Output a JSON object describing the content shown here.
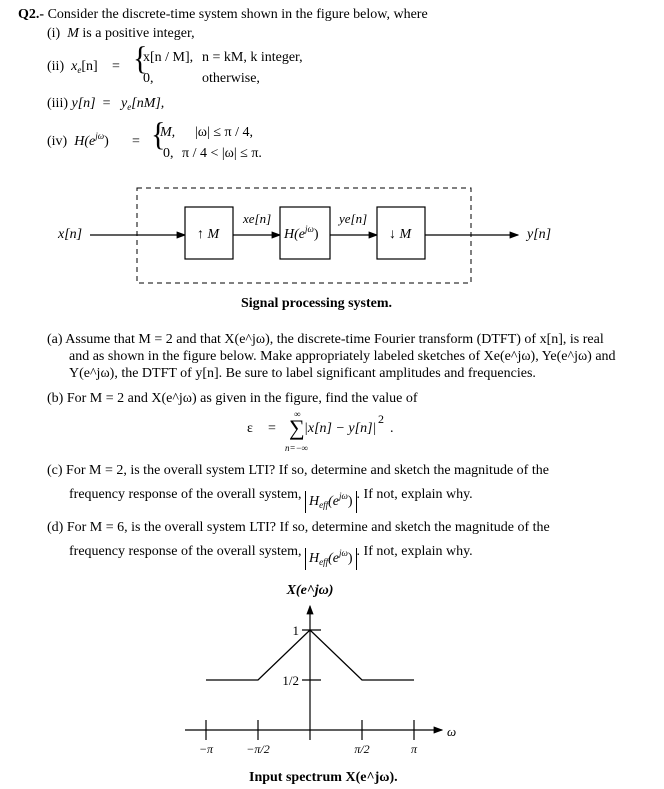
{
  "header": {
    "qnum": "Q2.-",
    "intro": "Consider the discrete-time system shown in the figure below, where"
  },
  "conditions": {
    "i": {
      "label": "(i)",
      "var": "M",
      "text": "is a positive integer,"
    },
    "ii": {
      "label": "(ii)",
      "lhs": "x",
      "lhs_sub": "e",
      "lhs_arg": "[n]",
      "eq": "=",
      "case1_expr": "x[n / M],",
      "case1_cond": "n = kM,  k integer,",
      "case2_expr": "0,",
      "case2_cond": "otherwise,"
    },
    "iii": {
      "label": "(iii)",
      "lhs": "y[n]",
      "eq": "=",
      "rhs": "y",
      "rhs_sub": "e",
      "rhs_arg": "[nM],"
    },
    "iv": {
      "label": "(iv)",
      "lhs": "H(e",
      "lhs_sup": "jω",
      "lhs_end": ")",
      "eq": "=",
      "case1_expr": "M,",
      "case1_cond": "|ω| ≤ π / 4,",
      "case2_expr": "0,",
      "case2_cond": "π / 4 < |ω| ≤ π."
    }
  },
  "diagram": {
    "input_label": "x[n]",
    "upsampler_label": "↑ M",
    "xe_label": "xe[n]",
    "filter_label": "H(e",
    "filter_sup": "jω",
    "filter_end": ")",
    "ye_label": "ye[n]",
    "downsampler_label": "↓ M",
    "output_label": "y[n]",
    "caption": "Signal processing system."
  },
  "parts": {
    "a": {
      "label": "(a)",
      "line1": "Assume that M = 2 and that X(e^jω), the discrete-time Fourier transform (DTFT) of x[n], is real",
      "line2": "and as shown in the figure below. Make appropriately labeled sketches of Xe(e^jω), Ye(e^jω) and",
      "line3": "Y(e^jω), the DTFT of y[n]. Be sure to label significant amplitudes and frequencies."
    },
    "b": {
      "label": "(b)",
      "text": "For M = 2 and X(e^jω) as given in the figure, find the value of",
      "eq_lhs": "ε",
      "eq_sign": "=",
      "sum_top": "∞",
      "sum_bottom": "n=−∞",
      "sum_symbol": "∑",
      "summand": "|x[n] − y[n]|",
      "power": "2",
      "end": "."
    },
    "c": {
      "label": "(c)",
      "line1": "For M = 2, is the overall system LTI? If so, determine and sketch the magnitude of the",
      "line2_pre": "frequency response of the overall system,",
      "heff": "H",
      "heff_sub": "eff",
      "heff_arg": "(e",
      "heff_sup": "jω",
      "heff_end": ")",
      "line2_post": ". If not, explain why."
    },
    "d": {
      "label": "(d)",
      "line1": "For M = 6, is the overall system LTI? If so, determine and sketch the magnitude of the",
      "line2_pre": "frequency response of the overall system,",
      "heff": "H",
      "heff_sub": "eff",
      "heff_arg": "(e",
      "heff_sup": "jω",
      "heff_end": ")",
      "line2_post": ". If not, explain why."
    }
  },
  "spectrum_caption": "Input spectrum X(e^jω).",
  "chart_data": {
    "type": "line",
    "title": "X(e^jω)",
    "xlabel": "ω",
    "ylabel": "X(e^jω)",
    "x": [
      -1.0,
      -0.5,
      0.0,
      0.5,
      1.0
    ],
    "x_units": "π rad",
    "series": [
      {
        "name": "X(e^jω)",
        "values": [
          0.5,
          0.5,
          1.0,
          0.5,
          0.5
        ]
      }
    ],
    "xticks": [
      -1.0,
      -0.5,
      0.5,
      1.0
    ],
    "xtick_labels": [
      "−π",
      "−π/2",
      "π/2",
      "π"
    ],
    "yticks": [
      0.5,
      1.0
    ],
    "ytick_labels": [
      "1/2",
      "1"
    ],
    "xlim": [
      -1.0,
      1.0
    ],
    "ylim": [
      0,
      1
    ],
    "grid": false,
    "caption": "Input spectrum X(e^jω)."
  }
}
